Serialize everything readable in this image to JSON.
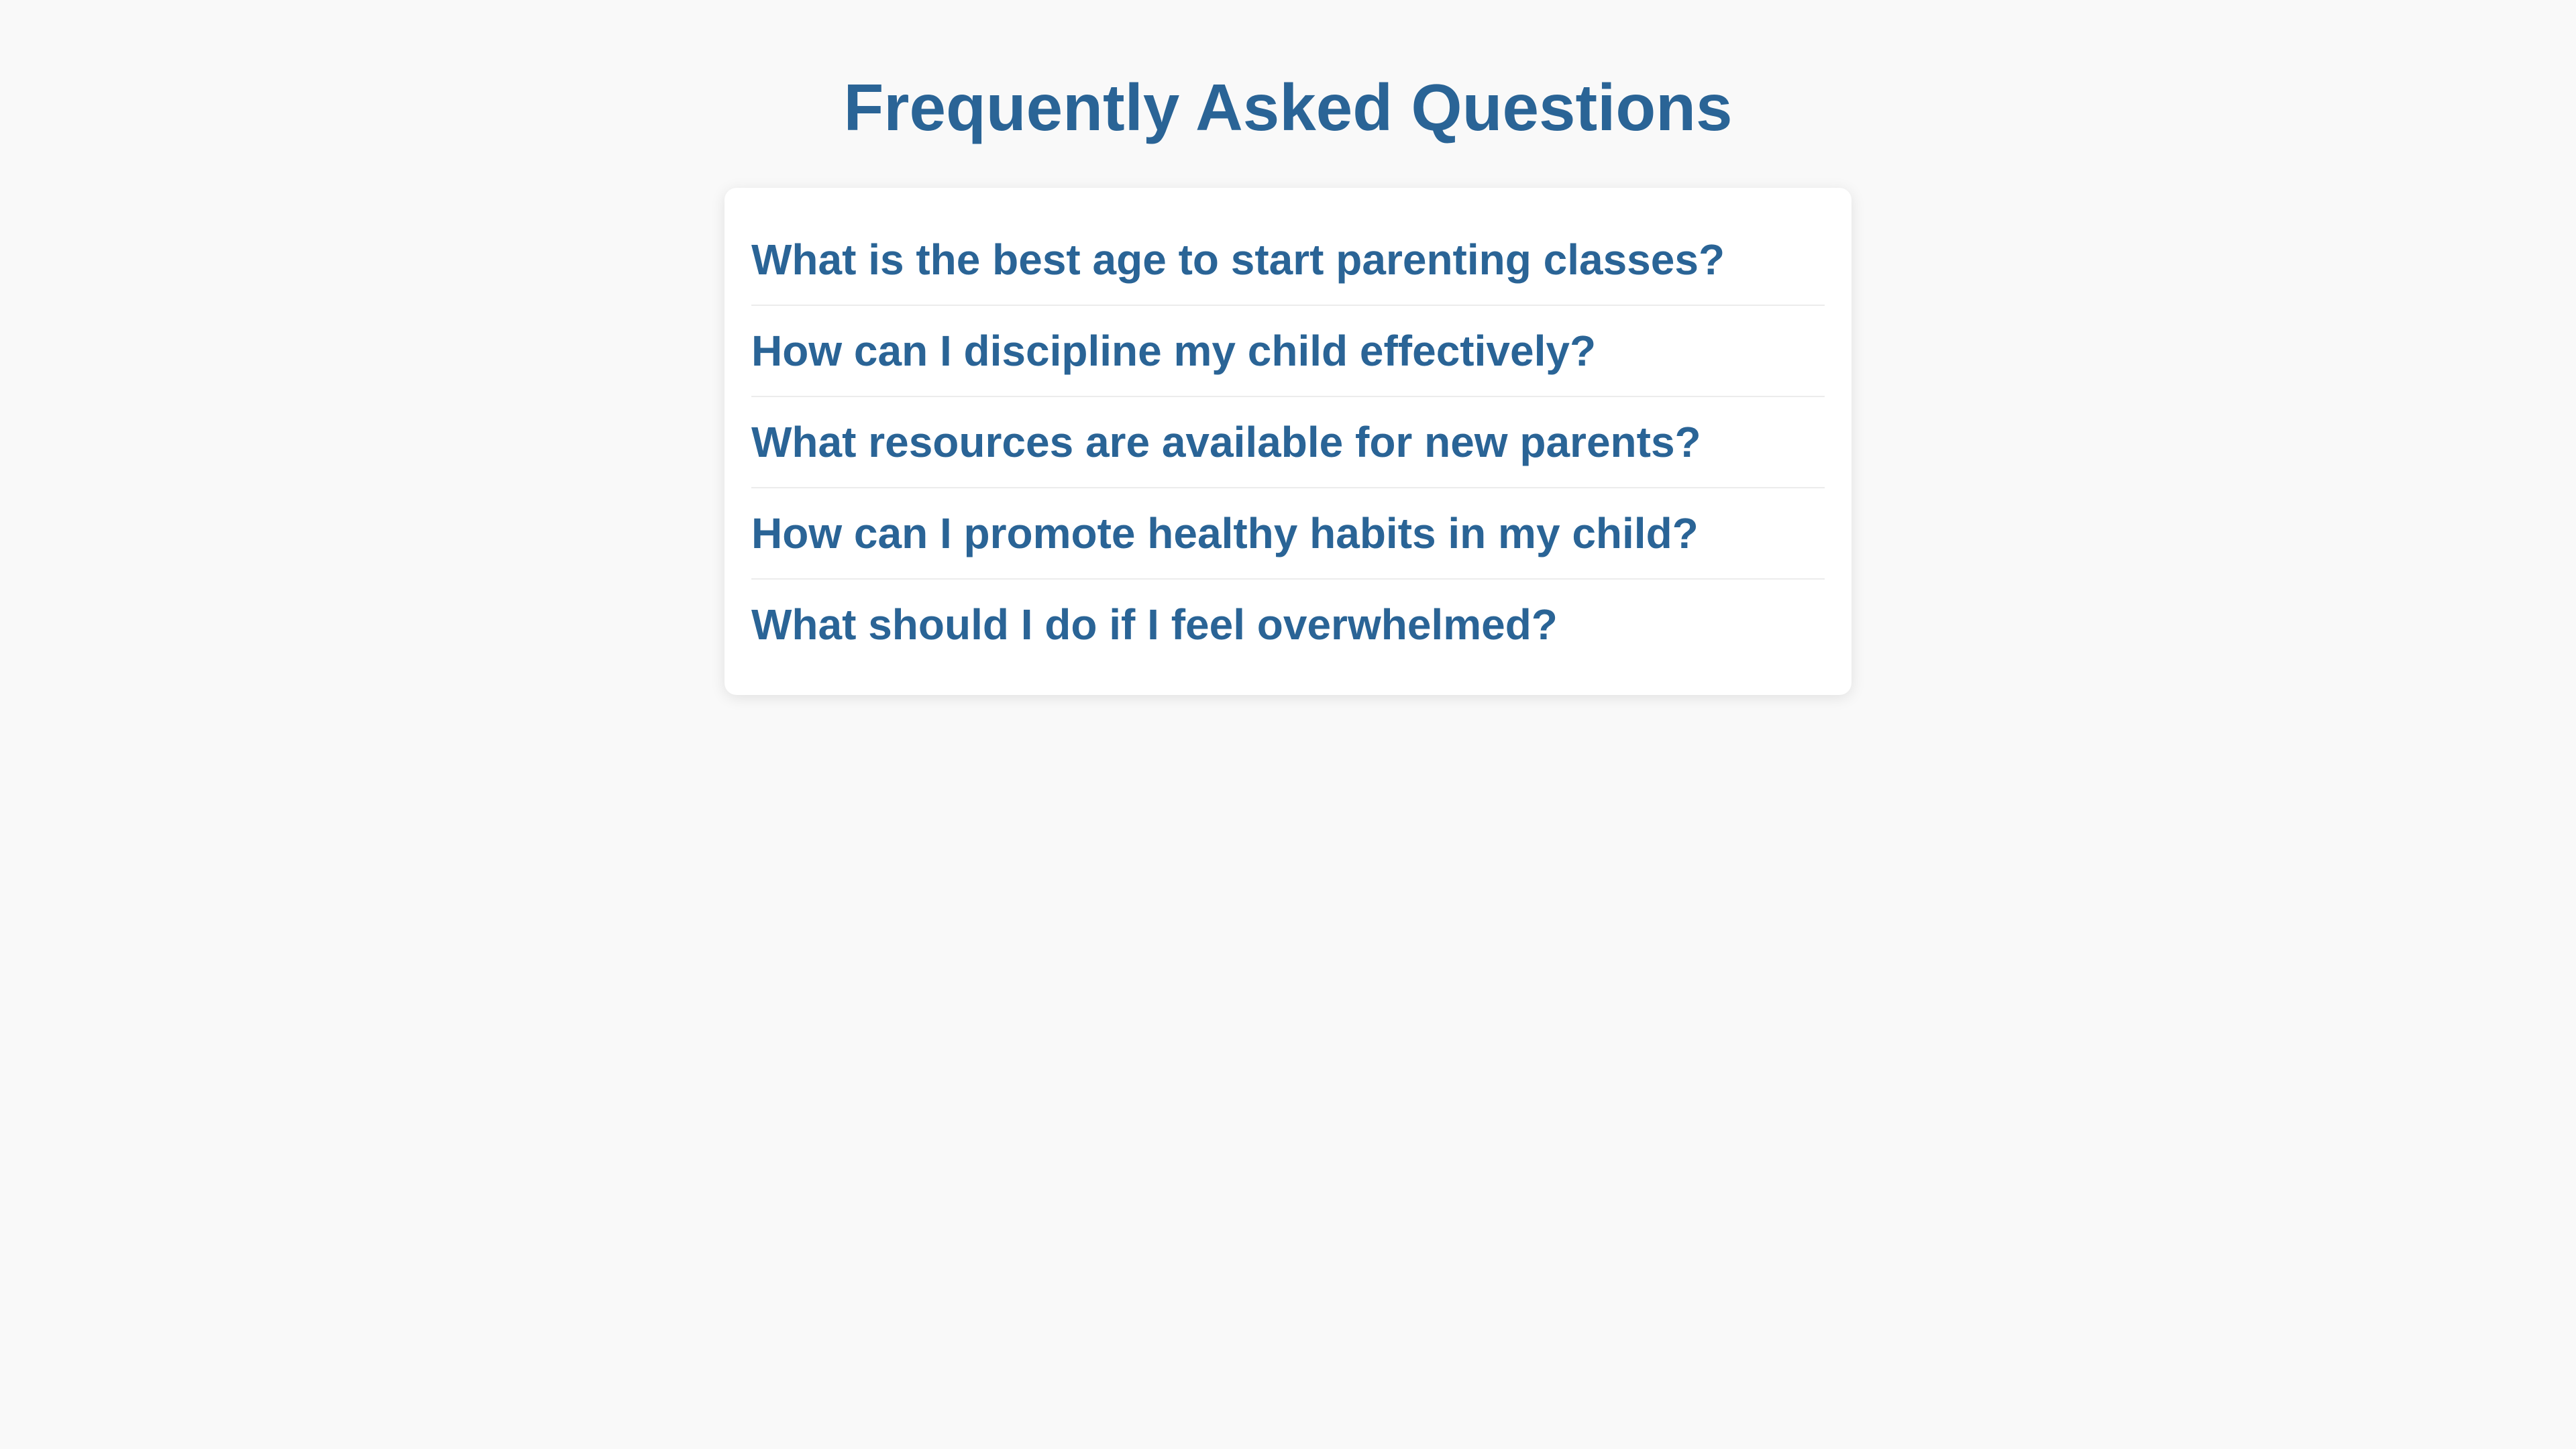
{
  "page": {
    "title": "Frequently Asked Questions"
  },
  "faq": {
    "items": [
      {
        "question": "What is the best age to start parenting classes?"
      },
      {
        "question": "How can I discipline my child effectively?"
      },
      {
        "question": "What resources are available for new parents?"
      },
      {
        "question": "How can I promote healthy habits in my child?"
      },
      {
        "question": "What should I do if I feel overwhelmed?"
      }
    ]
  },
  "colors": {
    "background": "#f9f9f9",
    "card": "#ffffff",
    "accent": "#2a6496",
    "divider": "#ececec"
  }
}
